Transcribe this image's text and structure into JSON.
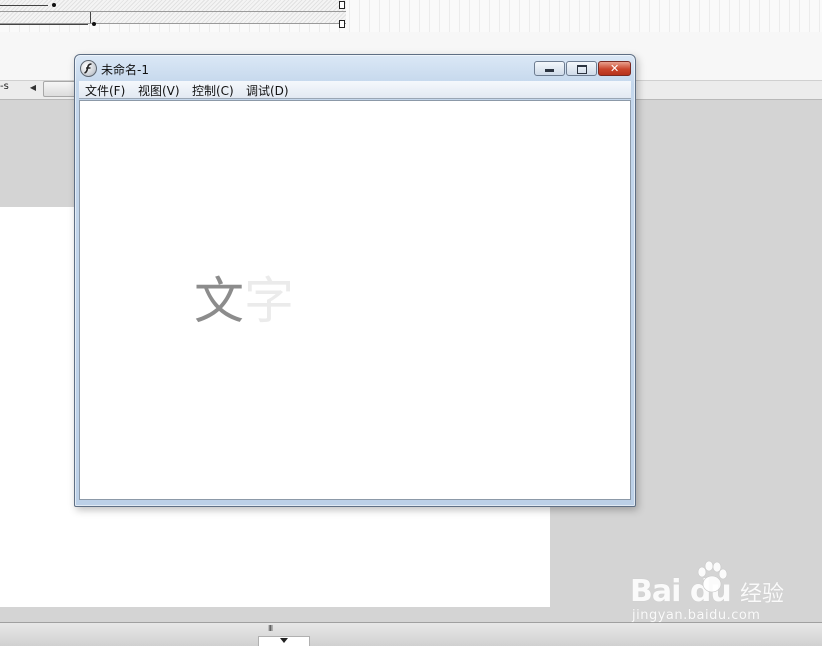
{
  "window": {
    "title": "未命名-1",
    "icon": "flash-player-icon",
    "controls": {
      "minimize": "minimize-icon",
      "maximize": "maximize-icon",
      "close": "close-icon",
      "close_glyph": "✕"
    }
  },
  "menubar": {
    "items": [
      {
        "label": "文件(F)"
      },
      {
        "label": "视图(V)"
      },
      {
        "label": "控制(C)"
      },
      {
        "label": "调试(D)"
      }
    ]
  },
  "stage": {
    "text_char1": "文",
    "text_char2": "字",
    "text_char1_color": "#8c8c8c",
    "text_char2_color": "#ebebeb"
  },
  "ide": {
    "scene_label": "-s",
    "scroll_left_glyph": "◀",
    "bottom_grip": "III"
  },
  "watermark": {
    "logo": "Bai du",
    "cn": "经验",
    "url": "jingyan.baidu.com"
  }
}
